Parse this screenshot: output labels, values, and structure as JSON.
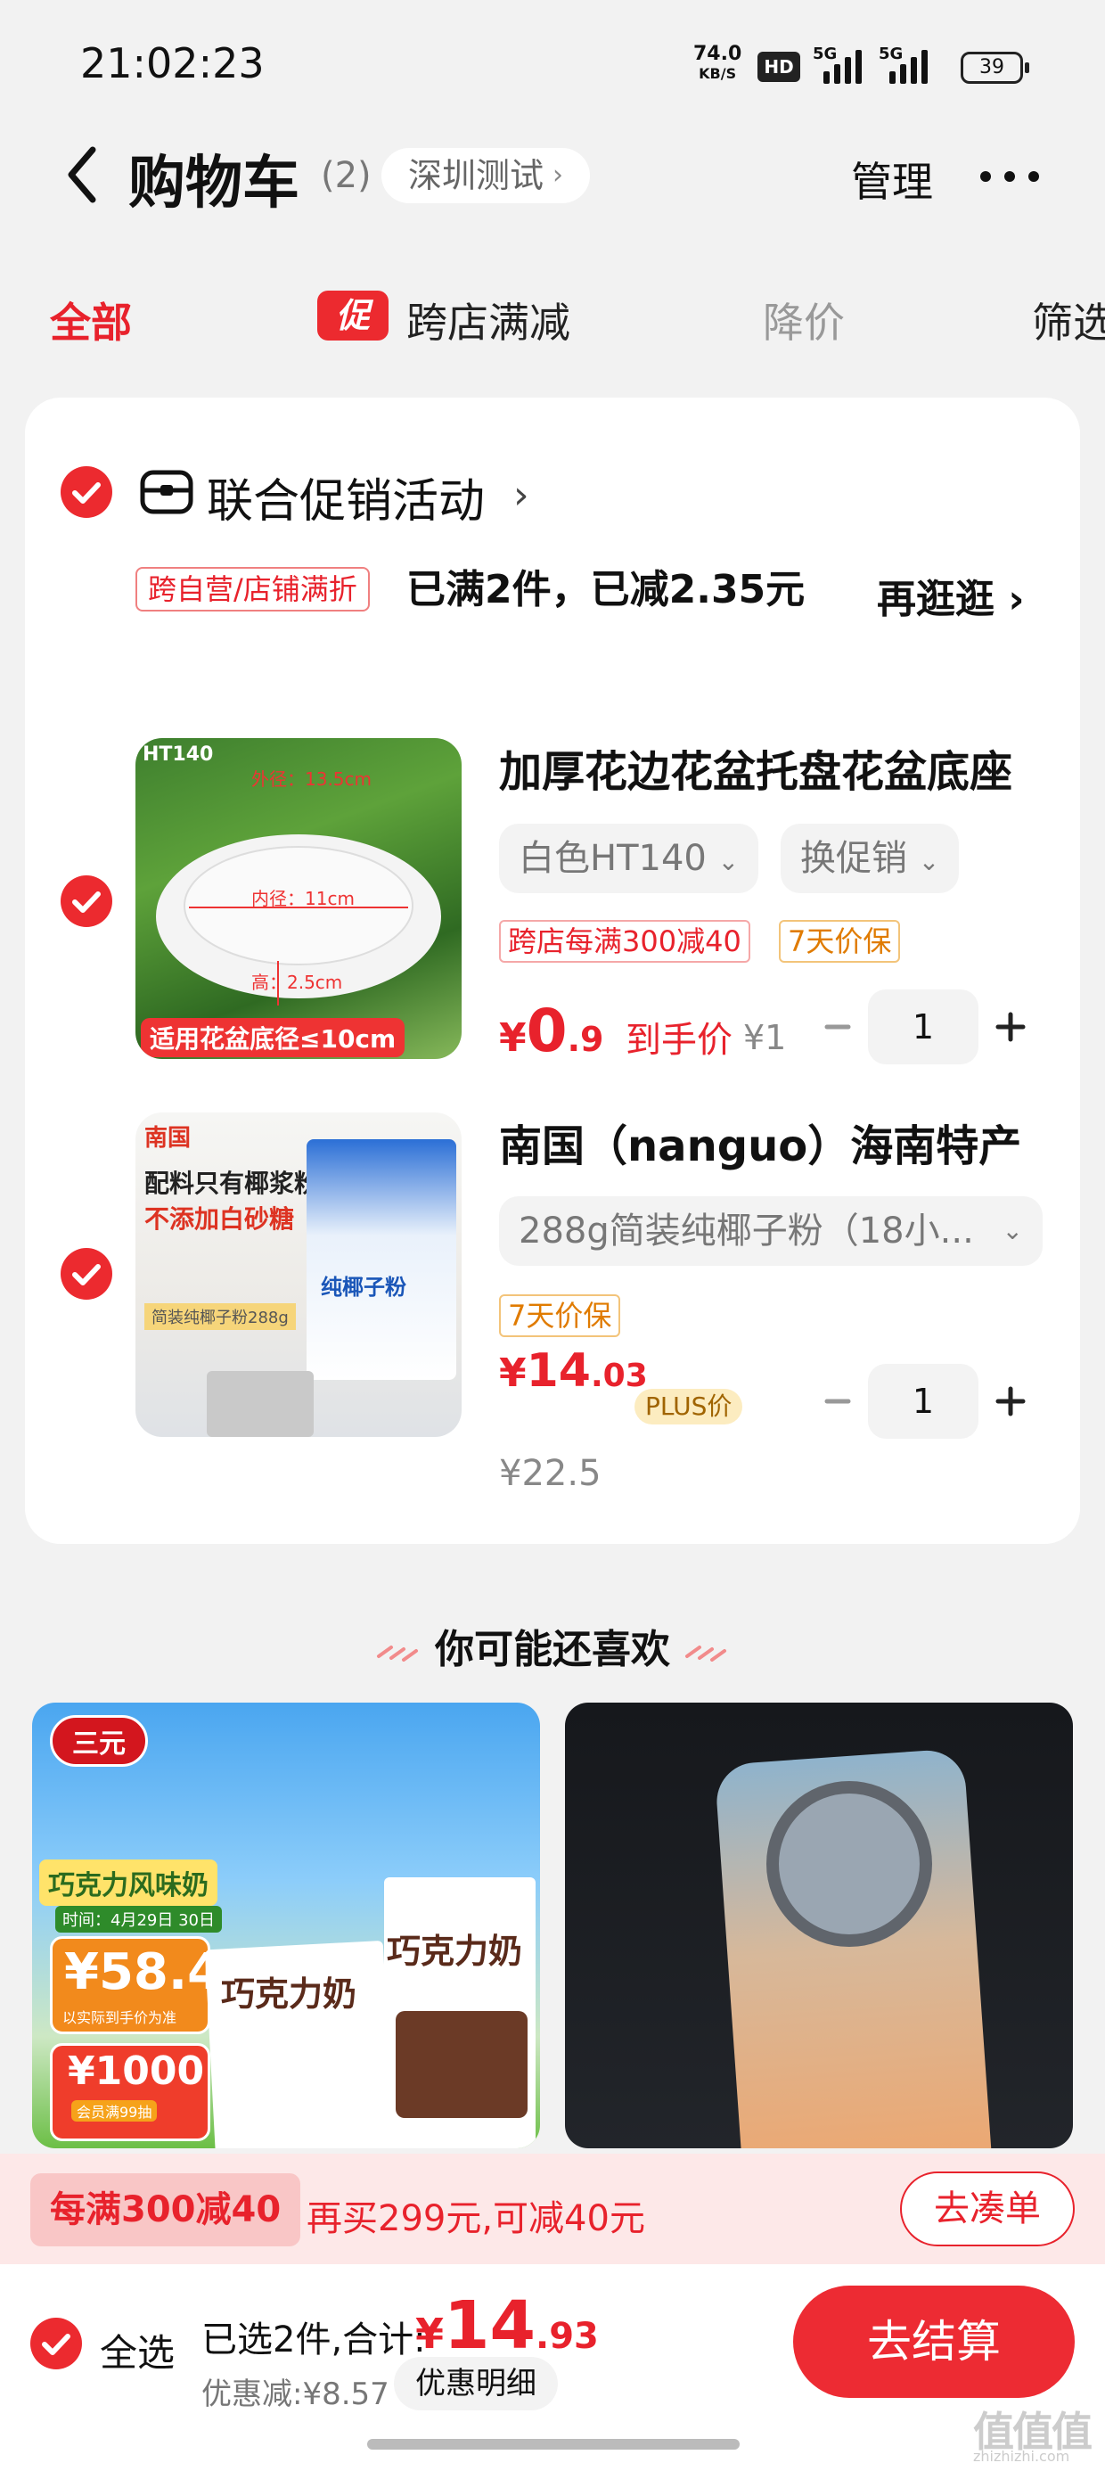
{
  "status_bar": {
    "time": "21:02:23",
    "net_speed_value": "74.0",
    "net_speed_unit": "KB/S",
    "hd_label": "HD",
    "signal1_label": "5G",
    "signal2_label": "5G",
    "battery": "39"
  },
  "header": {
    "title": "购物车",
    "count": "(2)",
    "location": "深圳测试",
    "manage": "管理",
    "more_icon": "more-dots-icon"
  },
  "tabs": {
    "all": "全部",
    "promo_badge": "促",
    "cross_store": "跨店满减",
    "price_drop": "降价",
    "filter": "筛选"
  },
  "store": {
    "name": "联合促销活动",
    "promo_tag": "跨自营/店铺满折",
    "promo_status": "已满2件，已减2.35元",
    "shop_more": "再逛逛"
  },
  "items": [
    {
      "title": "加厚花边花盆托盘花盆底座",
      "variant": "白色HT140",
      "promo_switch": "换促销",
      "tags": [
        "跨店每满300减40",
        "7天价保"
      ],
      "price_symbol": "¥",
      "price_int": "0",
      "price_dec": ".9",
      "price_label": "到手价",
      "orig_price": "¥1",
      "qty": "1",
      "image_text": {
        "brand": "HT140",
        "outer": "外径：13.5cm",
        "inner": "内径：11cm",
        "height": "高：2.5cm",
        "caption": "适用花盆底径≤10cm"
      }
    },
    {
      "title": "南国（nanguo）海南特产",
      "variant": "288g简装纯椰子粉（18小...",
      "tags": [
        "7天价保"
      ],
      "price_symbol": "¥",
      "price_int": "14",
      "price_dec": ".03",
      "plus_badge": "PLUS价",
      "orig_price": "¥22.5",
      "qty": "1",
      "image_text": {
        "brand": "南国",
        "line1": "配料只有椰浆粉",
        "line2": "不添加白砂糖",
        "pack_label": "纯椰子粉",
        "bottom": "简装纯椰子粉288g"
      }
    }
  ],
  "recommend": {
    "heading": "你可能还喜欢",
    "left": {
      "brand": "三元",
      "title": "巧克力风味奶",
      "date": "时间：4月29日 30日",
      "price": "¥58.4",
      "price_note": "以实际到手价为准",
      "coupon": "¥1000",
      "coupon_note": "会员满99抽",
      "box_label": "巧克力奶"
    }
  },
  "promo_strip": {
    "tag": "每满300减40",
    "text": "再买299元,可减40元",
    "button": "去凑单"
  },
  "bottom_bar": {
    "select_all": "全选",
    "summary": "已选2件,合计:",
    "total_symbol": "¥",
    "total_int": "14",
    "total_dec": ".93",
    "discount": "优惠减:¥8.57",
    "discount_detail": "优惠明细",
    "checkout": "去结算"
  },
  "watermark": {
    "main": "值值值",
    "sub": "zhizhizhi.com"
  },
  "colors": {
    "accent": "#e8222c",
    "background": "#f2f2f2",
    "card": "#ffffff"
  }
}
